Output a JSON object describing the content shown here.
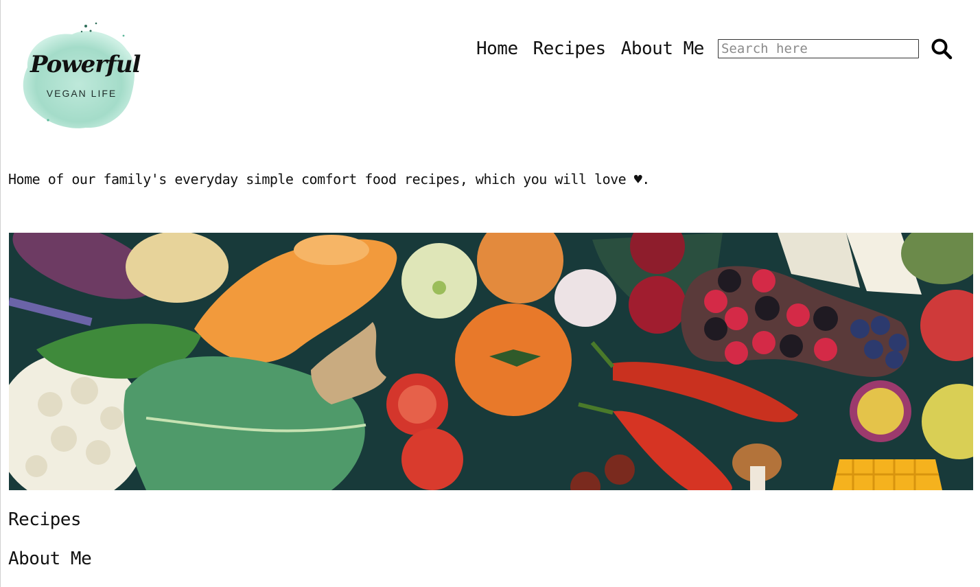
{
  "logo": {
    "brand": "Powerful",
    "tagline": "VEGAN LIFE"
  },
  "nav": {
    "items": [
      "Home",
      "Recipes",
      "About Me"
    ]
  },
  "search": {
    "placeholder": "Search here",
    "icon": "magnifier"
  },
  "intro": {
    "text": "Home of our family's everyday simple comfort food recipes, which you will love ♥."
  },
  "hero": {
    "subject": "assorted fresh vegetables and fruits on dark teal surface"
  },
  "sections": {
    "recipes": "Recipes",
    "about": "About Me"
  },
  "colors": {
    "logo_splash": "#9ad8c3",
    "hero_bg": "#183a3a"
  }
}
